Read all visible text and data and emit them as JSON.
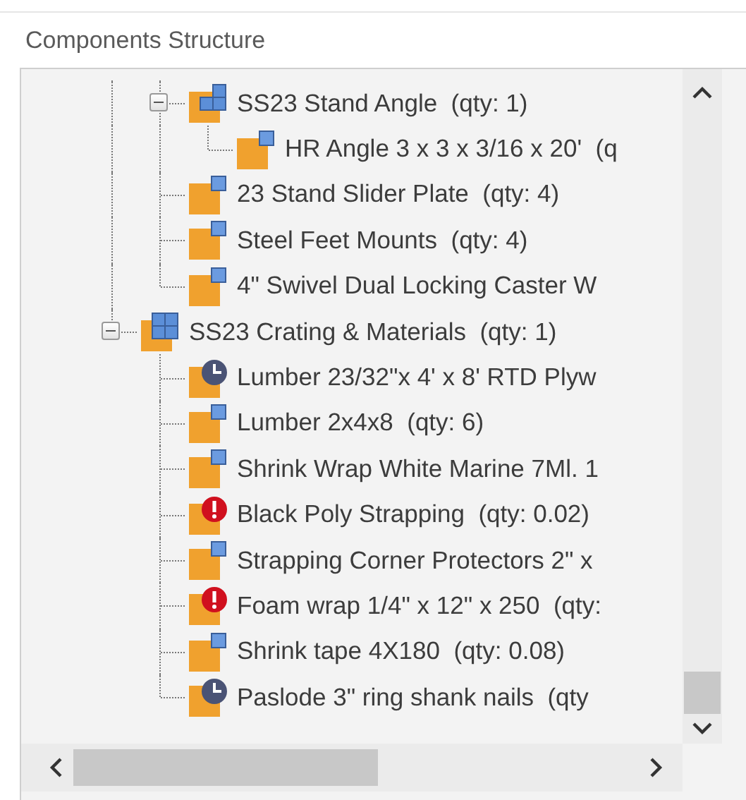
{
  "title": "Components Structure",
  "tree": {
    "items": [
      {
        "children": [
          {
            "label": "SS23 Stand Angle  (qty: 1)",
            "kind": "assembly",
            "expanded": true,
            "children": [
              {
                "label": "HR Angle 3 x 3 x 3/16 x 20'  (q",
                "kind": "part"
              }
            ]
          },
          {
            "label": "23 Stand Slider Plate  (qty: 4)",
            "kind": "part"
          },
          {
            "label": "Steel Feet Mounts  (qty: 4)",
            "kind": "part"
          },
          {
            "label": "4\" Swivel Dual Locking Caster W",
            "kind": "part"
          }
        ]
      },
      {
        "label": "SS23 Crating & Materials  (qty: 1)",
        "kind": "group",
        "expanded": true,
        "children": [
          {
            "label": "Lumber 23/32\"x 4' x 8' RTD Plyw",
            "kind": "pending"
          },
          {
            "label": "Lumber 2x4x8  (qty: 6)",
            "kind": "part"
          },
          {
            "label": "Shrink Wrap White Marine 7Ml. 1",
            "kind": "part"
          },
          {
            "label": "Black Poly Strapping  (qty: 0.02)",
            "kind": "warning"
          },
          {
            "label": "Strapping Corner Protectors 2\" x",
            "kind": "part"
          },
          {
            "label": "Foam wrap 1/4\" x 12\" x 250  (qty:",
            "kind": "warning"
          },
          {
            "label": "Shrink tape 4X180  (qty: 0.08)",
            "kind": "part"
          },
          {
            "label": "Paslode 3\" ring shank nails  (qty",
            "kind": "pending"
          }
        ]
      }
    ]
  }
}
